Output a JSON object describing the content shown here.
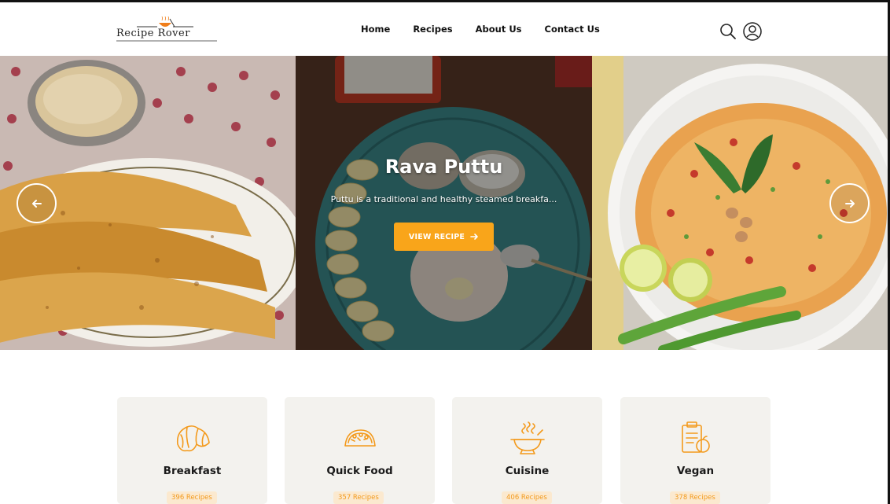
{
  "brand": {
    "name": "Recipe Rover",
    "accent": "#f9a51a"
  },
  "nav": {
    "items": [
      "Home",
      "Recipes",
      "About Us",
      "Contact Us"
    ]
  },
  "header_icons": [
    "search-icon",
    "user-icon"
  ],
  "hero": {
    "title": "Rava Puttu",
    "description": "Puttu is a traditional and healthy steamed breakfa...",
    "button_label": "VIEW RECIPE",
    "prev_icon": "arrow-left-icon",
    "next_icon": "arrow-right-icon"
  },
  "categories": [
    {
      "name": "Breakfast",
      "count": "396 Recipes",
      "icon": "croissant-icon"
    },
    {
      "name": "Quick Food",
      "count": "357 Recipes",
      "icon": "taco-icon"
    },
    {
      "name": "Cuisine",
      "count": "406 Recipes",
      "icon": "steaming-bowl-icon"
    },
    {
      "name": "Vegan",
      "count": "378 Recipes",
      "icon": "clipboard-apple-icon"
    }
  ]
}
